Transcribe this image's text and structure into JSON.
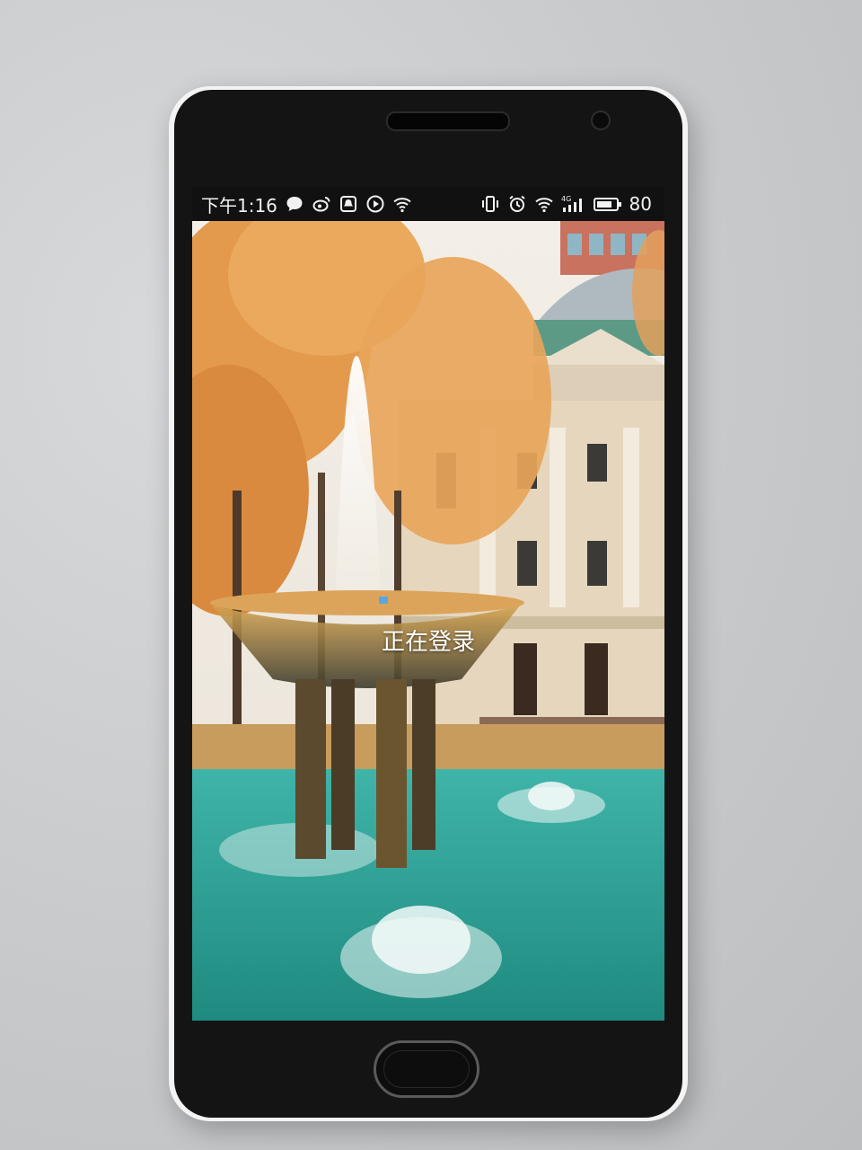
{
  "status_bar": {
    "time": "下午1:16",
    "battery_level": "80",
    "network_type": "4G",
    "left_icons": [
      "chat-bubble-icon",
      "weibo-icon",
      "qq-icon",
      "play-icon",
      "wifi-icon"
    ],
    "right_icons": [
      "vibrate-icon",
      "alarm-icon",
      "wifi-icon",
      "signal-4g-icon",
      "battery-icon"
    ]
  },
  "screen": {
    "login_status_text": "正在登录"
  },
  "colors": {
    "status_bar_bg": "#111111",
    "status_text": "#f2f2f2",
    "foliage": "#e39a4c",
    "water": "#2aa59a",
    "building": "#e6d6bd"
  }
}
